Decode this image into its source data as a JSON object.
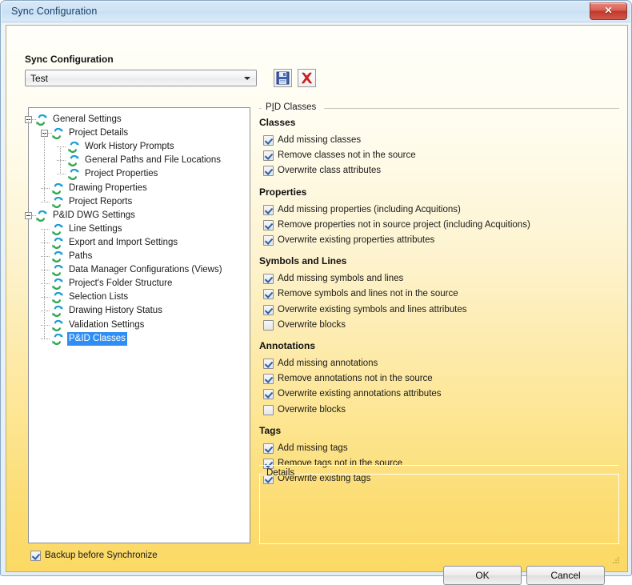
{
  "window": {
    "title": "Sync Configuration",
    "close_glyph": "✕",
    "close_icon": "close-icon"
  },
  "toolbar": {
    "config_label": "Sync Configuration",
    "config_value": "Test",
    "save_icon": "save-floppy-icon",
    "delete_icon": "delete-red-x-icon"
  },
  "tree": {
    "nodes": [
      {
        "label": "General Settings",
        "depth": 0,
        "expander": true,
        "selected": false
      },
      {
        "label": "Project Details",
        "depth": 1,
        "expander": true,
        "selected": false
      },
      {
        "label": "Work History Prompts",
        "depth": 2,
        "expander": false,
        "selected": false
      },
      {
        "label": "General Paths and File Locations",
        "depth": 2,
        "expander": false,
        "selected": false
      },
      {
        "label": "Project Properties",
        "depth": 2,
        "expander": false,
        "selected": false
      },
      {
        "label": "Drawing Properties",
        "depth": 1,
        "expander": false,
        "selected": false
      },
      {
        "label": "Project Reports",
        "depth": 1,
        "expander": false,
        "selected": false
      },
      {
        "label": "P&ID DWG Settings",
        "depth": 0,
        "expander": true,
        "selected": false
      },
      {
        "label": "Line Settings",
        "depth": 1,
        "expander": false,
        "selected": false
      },
      {
        "label": "Export and Import Settings",
        "depth": 1,
        "expander": false,
        "selected": false
      },
      {
        "label": "Paths",
        "depth": 1,
        "expander": false,
        "selected": false
      },
      {
        "label": "Data Manager Configurations (Views)",
        "depth": 1,
        "expander": false,
        "selected": false
      },
      {
        "label": "Project's Folder Structure",
        "depth": 1,
        "expander": false,
        "selected": false
      },
      {
        "label": "Selection Lists",
        "depth": 1,
        "expander": false,
        "selected": false
      },
      {
        "label": "Drawing History Status",
        "depth": 1,
        "expander": false,
        "selected": false
      },
      {
        "label": "Validation Settings",
        "depth": 1,
        "expander": false,
        "selected": false
      },
      {
        "label": "P&ID Classes",
        "depth": 1,
        "expander": false,
        "selected": true
      }
    ]
  },
  "right_pane": {
    "group_label_pre": "P",
    "group_label_mnemonic": "I",
    "group_label_post": "D Classes",
    "sections": [
      {
        "title": "Classes",
        "items": [
          {
            "label": "Add missing classes",
            "checked": true
          },
          {
            "label": "Remove classes not in the source",
            "checked": true
          },
          {
            "label": "Overwrite class attributes",
            "checked": true
          }
        ]
      },
      {
        "title": "Properties",
        "items": [
          {
            "label": "Add missing properties (including Acquitions)",
            "checked": true
          },
          {
            "label": "Remove properties not in source project (including Acquitions)",
            "checked": true
          },
          {
            "label": "Overwrite existing properties attributes",
            "checked": true
          }
        ]
      },
      {
        "title": "Symbols and Lines",
        "items": [
          {
            "label": "Add missing symbols and lines",
            "checked": true
          },
          {
            "label": "Remove symbols and lines not in the source",
            "checked": true
          },
          {
            "label": "Overwrite existing symbols and lines attributes",
            "checked": true
          },
          {
            "label": "Overwrite blocks",
            "checked": false
          }
        ]
      },
      {
        "title": "Annotations",
        "items": [
          {
            "label": "Add missing annotations",
            "checked": true
          },
          {
            "label": "Remove annotations not in the source",
            "checked": true
          },
          {
            "label": "Overwrite existing annotations attributes",
            "checked": true
          },
          {
            "label": "Overwrite blocks",
            "checked": false
          }
        ]
      },
      {
        "title": "Tags",
        "items": [
          {
            "label": "Add missing tags",
            "checked": true
          },
          {
            "label": "Remove tags not in the source",
            "checked": true
          },
          {
            "label": "Overwrite existing tags",
            "checked": true
          }
        ]
      }
    ],
    "details_label": "Details",
    "details_content": ""
  },
  "footer": {
    "backup_label": "Backup before Synchronize",
    "backup_checked": true,
    "ok_label": "OK",
    "cancel_label": "Cancel"
  },
  "colors": {
    "accent_selection": "#2f8ef4",
    "body_top": "#fffef9",
    "body_bottom": "#fcd964",
    "title_bar": "#cfe3f5",
    "close_red": "#c0392b",
    "check_blue": "#2b5fa8"
  }
}
